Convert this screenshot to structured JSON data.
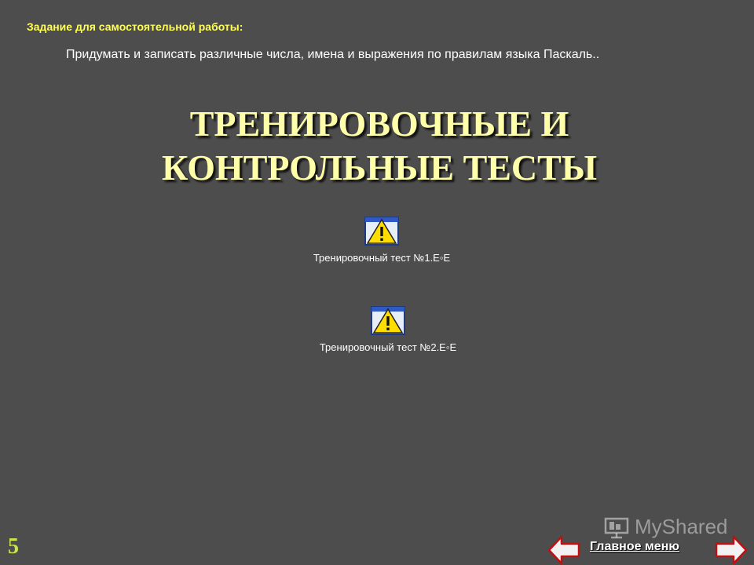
{
  "task": {
    "heading": "Задание для самостоятельной работы:",
    "text": "Придумать и записать различные числа, имена и выражения по правилам языка Паскаль.."
  },
  "title": {
    "line1": "ТРЕНИРОВОЧНЫЕ И",
    "line2": "КОНТРОЛЬНЫЕ ТЕСТЫ"
  },
  "tests": [
    {
      "label": "Тренировочный тест №1.Е◦Е",
      "icon": "warning-icon"
    },
    {
      "label": "Тренировочный тест №2.Е◦Е",
      "icon": "warning-icon"
    }
  ],
  "footer": {
    "slide_number": "5",
    "main_menu": "Главное меню",
    "watermark": "MyShared"
  },
  "colors": {
    "background": "#4d4d4d",
    "heading": "#ffff55",
    "title": "#ffffaa",
    "slide_number": "#c8e64a"
  }
}
